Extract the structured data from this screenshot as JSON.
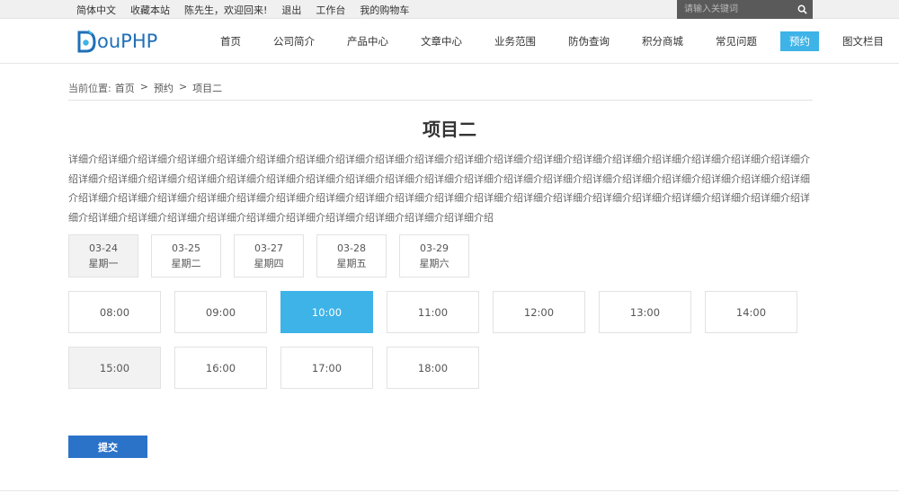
{
  "topbar": {
    "links": [
      "简体中文",
      "收藏本站",
      "陈先生，欢迎回来!",
      "退出",
      "工作台",
      "我的购物车"
    ],
    "search_placeholder": "请输入关键词"
  },
  "logo": {
    "text": "ouPHP"
  },
  "nav": {
    "items": [
      "首页",
      "公司简介",
      "产品中心",
      "文章中心",
      "业务范围",
      "防伪查询",
      "积分商城",
      "常见问题",
      "预约",
      "图文栏目"
    ],
    "active": "预约"
  },
  "breadcrumb": {
    "label": "当前位置:",
    "items": [
      "首页",
      ">",
      "预约",
      ">",
      "项目二"
    ]
  },
  "title": "项目二",
  "description": "详细介绍详细介绍详细介绍详细介绍详细介绍详细介绍详细介绍详细介绍详细介绍详细介绍详细介绍详细介绍详细介绍详细介绍详细介绍详细介绍详细介绍详细介绍详细介绍详细介绍详细介绍详细介绍详细介绍详细介绍详细介绍详细介绍详细介绍详细介绍详细介绍详细介绍详细介绍详细介绍详细介绍详细介绍详细介绍详细介绍详细介绍详细介绍详细介绍详细介绍详细介绍详细介绍详细介绍详细介绍详细介绍详细介绍详细介绍详细介绍详细介绍详细介绍详细介绍详细介绍详细介绍详细介绍详细介绍详细介绍详细介绍详细介绍详细介绍详细介绍详细介绍详细介绍详细介绍详细介绍详细介绍详细介绍详细介绍",
  "dates": [
    {
      "date": "03-24",
      "weekday": "星期一",
      "selected": true
    },
    {
      "date": "03-25",
      "weekday": "星期二",
      "selected": false
    },
    {
      "date": "03-27",
      "weekday": "星期四",
      "selected": false
    },
    {
      "date": "03-28",
      "weekday": "星期五",
      "selected": false
    },
    {
      "date": "03-29",
      "weekday": "星期六",
      "selected": false
    }
  ],
  "times": [
    {
      "time": "08:00",
      "state": "normal"
    },
    {
      "time": "09:00",
      "state": "normal"
    },
    {
      "time": "10:00",
      "state": "active"
    },
    {
      "time": "11:00",
      "state": "normal"
    },
    {
      "time": "12:00",
      "state": "normal"
    },
    {
      "time": "13:00",
      "state": "normal"
    },
    {
      "time": "14:00",
      "state": "normal"
    },
    {
      "time": "15:00",
      "state": "disabled"
    },
    {
      "time": "16:00",
      "state": "normal"
    },
    {
      "time": "17:00",
      "state": "normal"
    },
    {
      "time": "18:00",
      "state": "normal"
    }
  ],
  "submit_label": "提交",
  "colors": {
    "accent": "#3db3e8",
    "submit": "#2b72c9",
    "logo": "#1f6fb8"
  }
}
